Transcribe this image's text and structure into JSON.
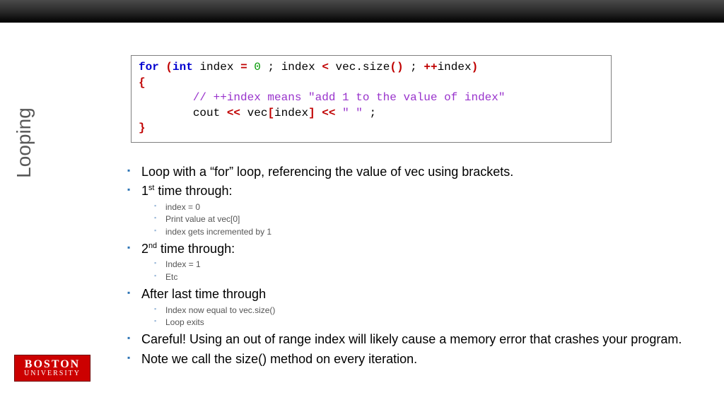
{
  "side_title": "Looping",
  "code": {
    "l1a": "for",
    "l1b": "int",
    "l1c": " index ",
    "l1d": "=",
    "l1e": "0",
    "l1f": " ; index ",
    "l1g": "<",
    "l1h": " vec.size",
    "l1i": "()",
    "l1j": " ; ",
    "l1k": "++",
    "l1l": "index",
    "l1m": ")",
    "l2a": "{",
    "l3a": "        ",
    "l3b": "// ++index means \"add 1 to the value of index\"",
    "l4a": "        cout ",
    "l4b": "<<",
    "l4c": " vec",
    "l4d": "[",
    "l4e": "index",
    "l4f": "]",
    "l4g": "<<",
    "l4h": "\" \"",
    "l4i": " ;",
    "l5a": "}"
  },
  "b1": "Loop with a “for” loop, referencing the value of vec using brackets.",
  "b2_pre": "1",
  "b2_sup": "st",
  "b2_post": " time through:",
  "b2s1": "index = 0",
  "b2s2": "Print value at vec[0]",
  "b2s3": "index gets incremented by 1",
  "b3_pre": "2",
  "b3_sup": "nd",
  "b3_post": " time through:",
  "b3s1": "Index = 1",
  "b3s2": "Etc",
  "b4": "After last time through",
  "b4s1": "Index now equal to vec.size()",
  "b4s2": "Loop exits",
  "b5": "Careful!  Using an out of range index will likely cause a memory error that crashes your program.",
  "b6": "Note we call the size() method on every iteration.",
  "logo_l1": "BOSTON",
  "logo_l2": "UNIVERSITY"
}
